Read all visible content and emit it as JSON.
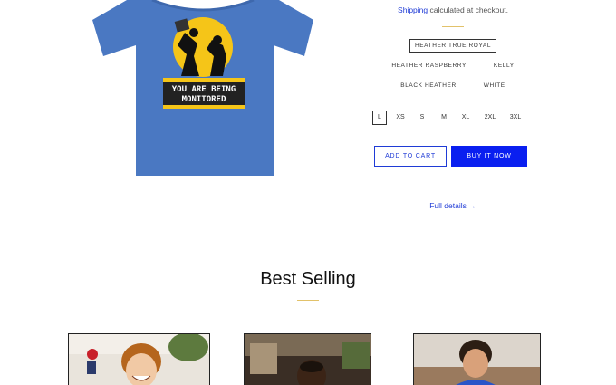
{
  "product": {
    "image_caption": "YOU ARE BEING MONITORED",
    "shipping_link": "Shipping",
    "shipping_text": " calculated at checkout.",
    "colors": [
      [
        "Heather True Royal"
      ],
      [
        "Heather Raspberry",
        "Kelly"
      ],
      [
        "Black Heather",
        "White"
      ]
    ],
    "selected_color": "Heather True Royal",
    "sizes": [
      "L",
      "XS",
      "S",
      "M",
      "XL",
      "2XL",
      "3XL"
    ],
    "selected_size": "L",
    "add_to_cart": "Add to cart",
    "buy_now": "Buy it now",
    "full_details": "Full details",
    "full_details_arrow": "→"
  },
  "best_selling": {
    "title": "Best Selling"
  },
  "colors": {
    "accent": "#1f3bd6",
    "buy_button": "#0a1ff0",
    "divider": "#e2c26a",
    "shirt": "#4a78c2"
  }
}
